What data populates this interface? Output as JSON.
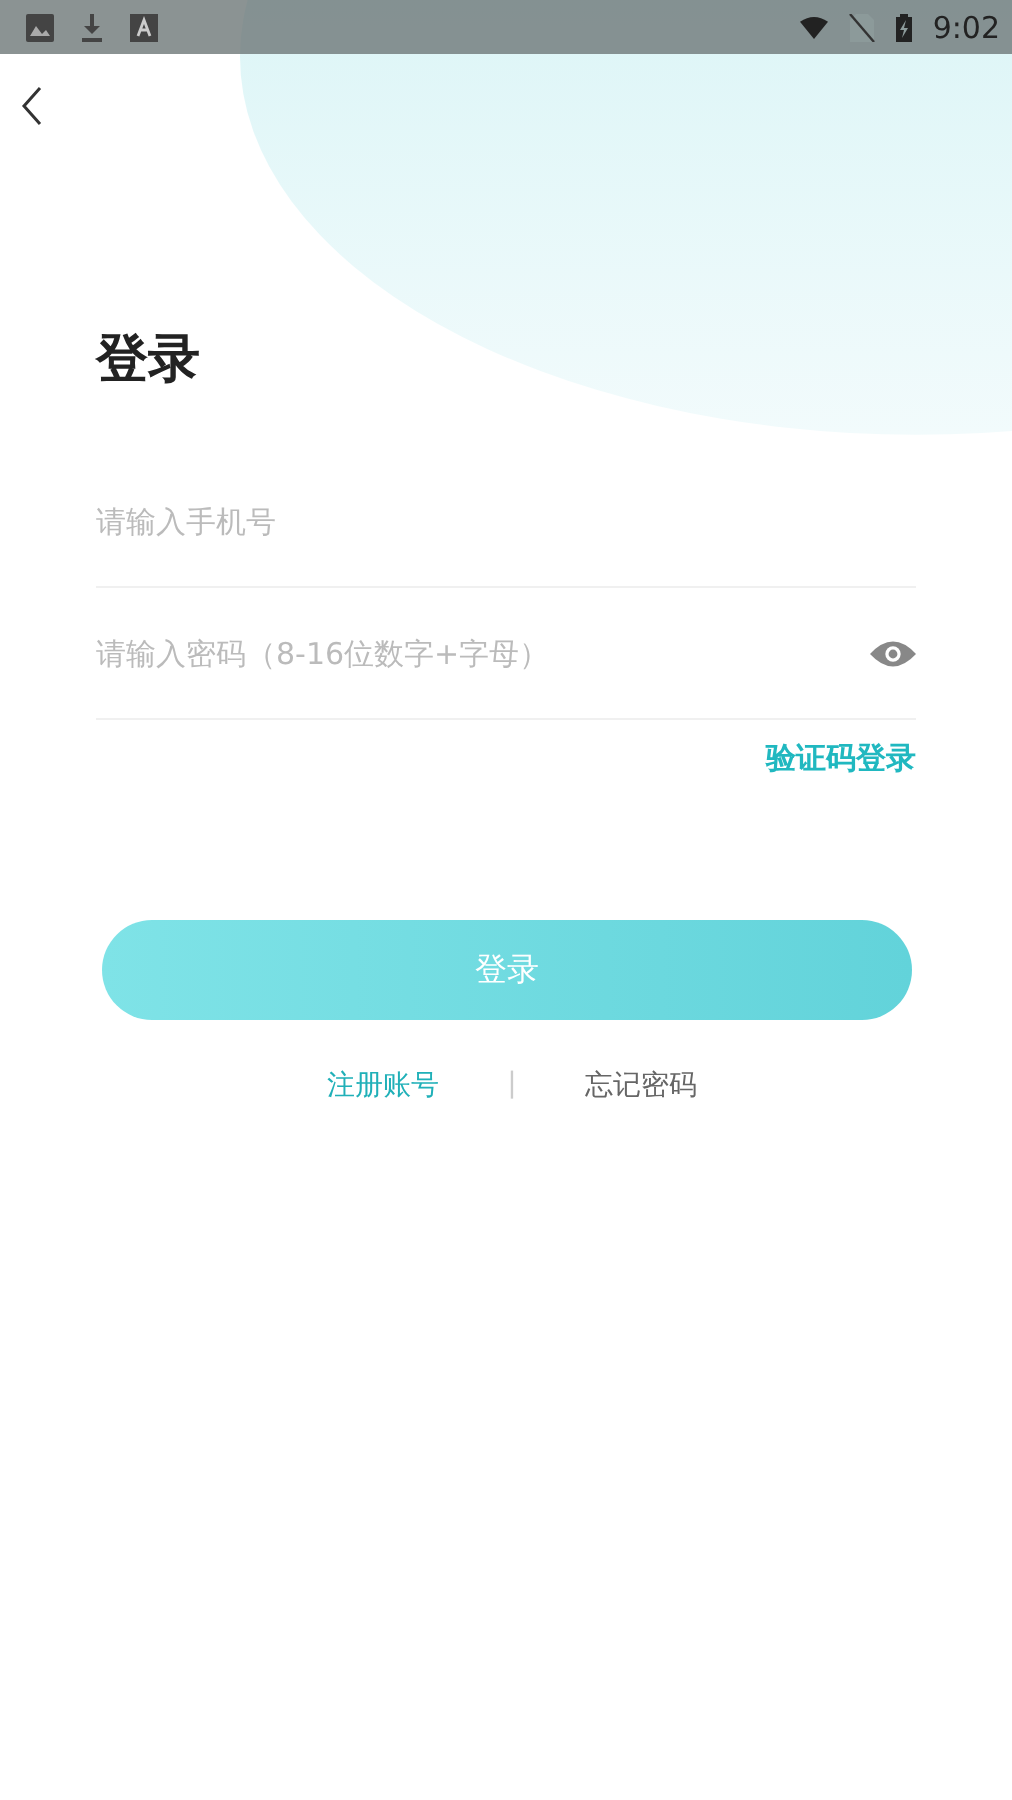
{
  "status_bar": {
    "time": "9:02"
  },
  "title": "登录",
  "phone_field": {
    "placeholder": "请输入手机号"
  },
  "password_field": {
    "placeholder": "请输入密码（8-16位数字+字母）"
  },
  "code_login_link": "验证码登录",
  "login_button": "登录",
  "footer_links": [
    {
      "label": "注册账号",
      "kind": "accent"
    },
    {
      "label": "|",
      "kind": "separator"
    },
    {
      "label": "忘记密码",
      "kind": "plain"
    }
  ]
}
